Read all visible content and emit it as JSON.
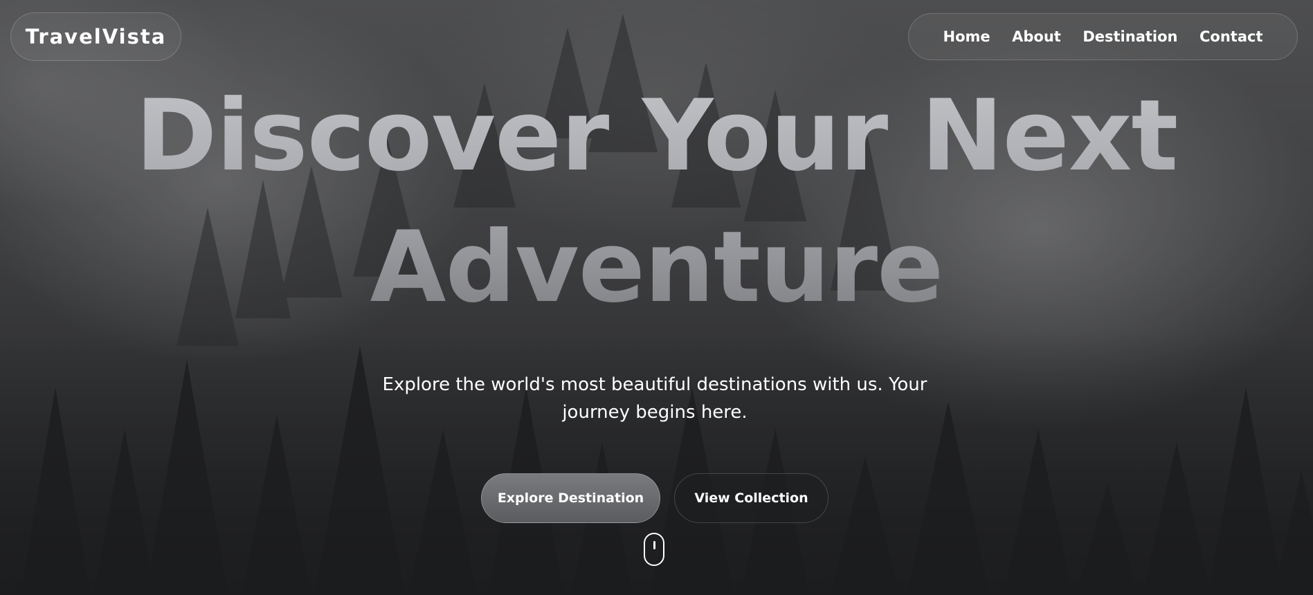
{
  "brand": {
    "name": "TravelVista"
  },
  "nav": {
    "items": [
      {
        "label": "Home"
      },
      {
        "label": "About"
      },
      {
        "label": "Destination"
      },
      {
        "label": "Contact"
      }
    ]
  },
  "hero": {
    "title_line1": "Discover Your Next",
    "title_line2": "Adventure",
    "subtitle": "Explore the world's most beautiful destinations with us. Your journey begins here.",
    "primary_button": "Explore Destination",
    "secondary_button": "View Collection",
    "background": "misty-pine-forest"
  },
  "icons": {
    "scroll_indicator": "mouse-scroll-icon"
  },
  "colors": {
    "text": "#ffffff",
    "headline_top": "#c3c4c8",
    "headline_bottom": "#7d7e82",
    "primary_button": "#6a6b6e"
  }
}
